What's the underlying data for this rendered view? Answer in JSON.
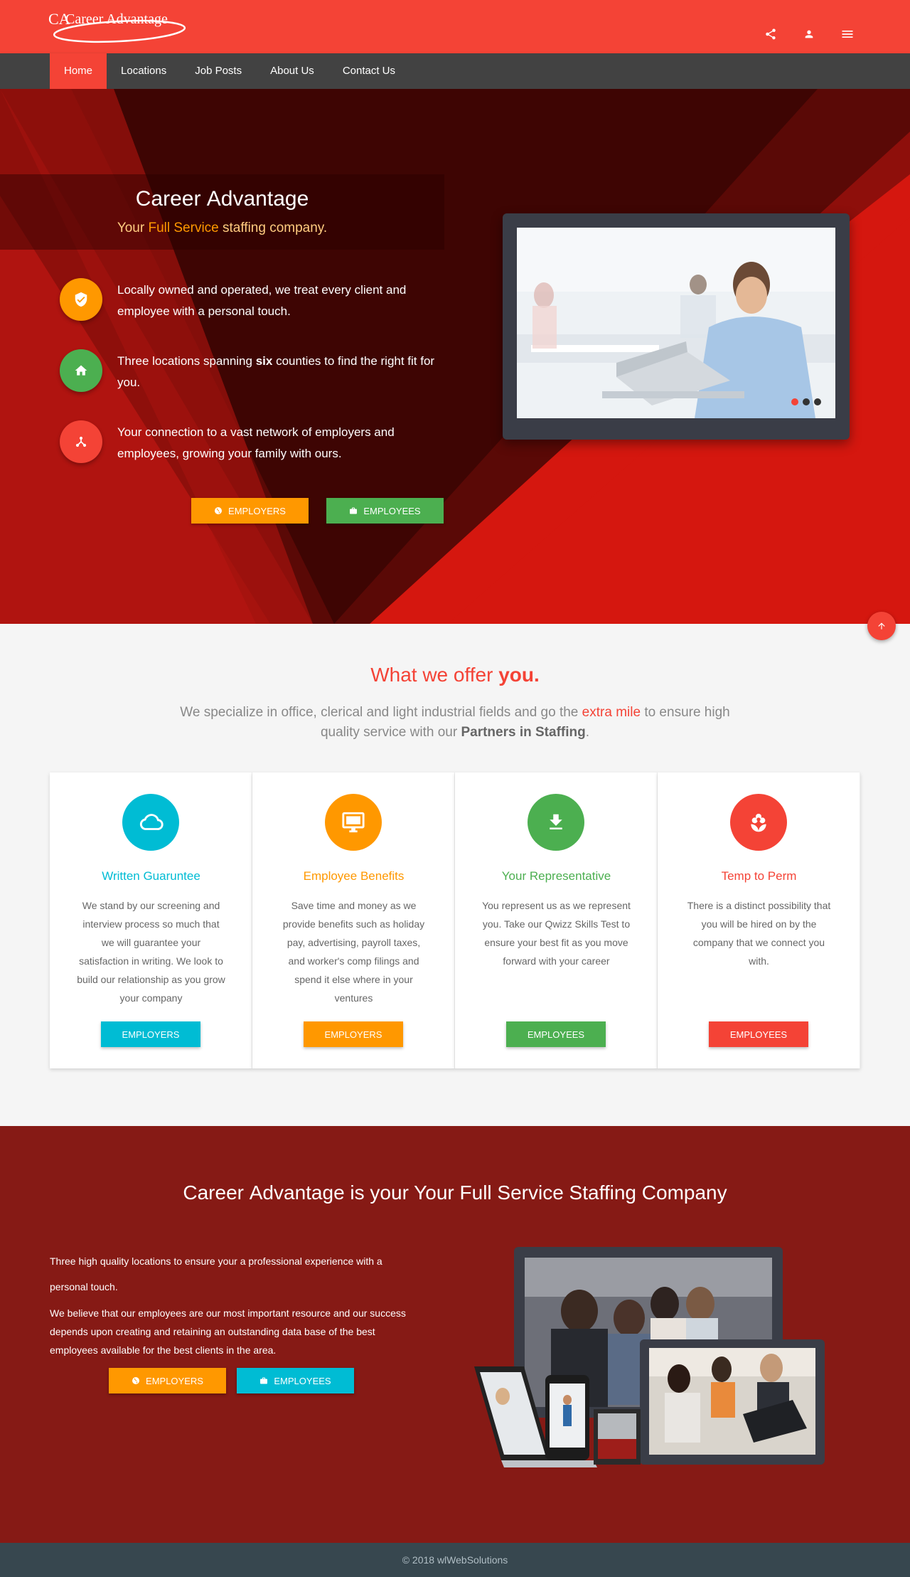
{
  "brand": {
    "logo_mark": "CA",
    "logo_text": "Career Advantage"
  },
  "topbar": {
    "icons": [
      "share-icon",
      "account-icon",
      "menu-icon"
    ]
  },
  "nav": {
    "items": [
      {
        "label": "Home",
        "active": true
      },
      {
        "label": "Locations"
      },
      {
        "label": "Job Posts"
      },
      {
        "label": "About Us"
      },
      {
        "label": "Contact Us"
      }
    ]
  },
  "hero": {
    "title_light": "Career",
    "title_strong": "Advantage",
    "subtitle_pre": "Your",
    "subtitle_hl": "Full Service",
    "subtitle_post": "staffing company.",
    "features": [
      {
        "icon": "verified-shield-icon",
        "color": "#ff9800",
        "text": "Locally owned and operated, we treat every client and employee with a personal touch."
      },
      {
        "icon": "home-icon",
        "color": "#4caf50",
        "text_pre": "Three locations spanning",
        "text_bold": "six",
        "text_post": "counties to find the right fit for you."
      },
      {
        "icon": "network-icon",
        "color": "#f44336",
        "text": "Your connection to a vast network of employers and employees, growing your family with ours."
      }
    ],
    "buttons": [
      {
        "label": "Employers",
        "icon": "globe-icon",
        "color": "#ff9800"
      },
      {
        "label": "Employees",
        "icon": "briefcase-icon",
        "color": "#4caf50"
      }
    ],
    "carousel_slides": 3,
    "carousel_active": 1
  },
  "offer": {
    "title_pre": "What we offer",
    "title_bold": "you.",
    "desc_1": "We specialize in office, clerical and light industrial fields and go the",
    "desc_hl": "extra mile",
    "desc_2": "to ensure high quality service with our",
    "desc_bold": "Partners in Staffing",
    "desc_end": ".",
    "cards": [
      {
        "icon": "cloud-icon",
        "color": "#00bcd4",
        "title": "Written Guaruntee",
        "text": "We stand by our screening and interview process so much that we will guarantee your satisfaction in writing. We look to build our relationship as you grow your company",
        "button": "Employers"
      },
      {
        "icon": "monitor-icon",
        "color": "#ff9800",
        "title": "Employee Benefits",
        "text": "Save time and money as we provide benefits such as holiday pay, advertising, payroll taxes, and worker's comp filings and spend it else where in your ventures",
        "button": "Employers"
      },
      {
        "icon": "download-icon",
        "color": "#4caf50",
        "title": "Your Representative",
        "text": "You represent us as we represent you. Take our Qwizz Skills Test to ensure your best fit as you move forward with your career",
        "button": "Employees"
      },
      {
        "icon": "flower-icon",
        "color": "#f44336",
        "title": "Temp to Perm",
        "text": "There is a distinct possibility that you will be hired on by the company that we connect you with.",
        "button": "Employees"
      }
    ]
  },
  "bottom": {
    "title_pre": "Career",
    "title_strong": "Advantage",
    "title_post": "is your Your Full Service Staffing Company",
    "para_1": "Three high quality locations to ensure your a professional experience with a personal touch.",
    "para_2": "We believe that our employees are our most important resource and our success depends upon creating and retaining an outstanding data base of the best employees available for the best clients in the area.",
    "buttons": [
      {
        "label": "Employers",
        "icon": "globe-icon",
        "color": "#ff9800"
      },
      {
        "label": "Employees",
        "icon": "briefcase-icon",
        "color": "#00bcd4"
      }
    ]
  },
  "footer": {
    "text": "© 2018 wlWebSolutions"
  }
}
